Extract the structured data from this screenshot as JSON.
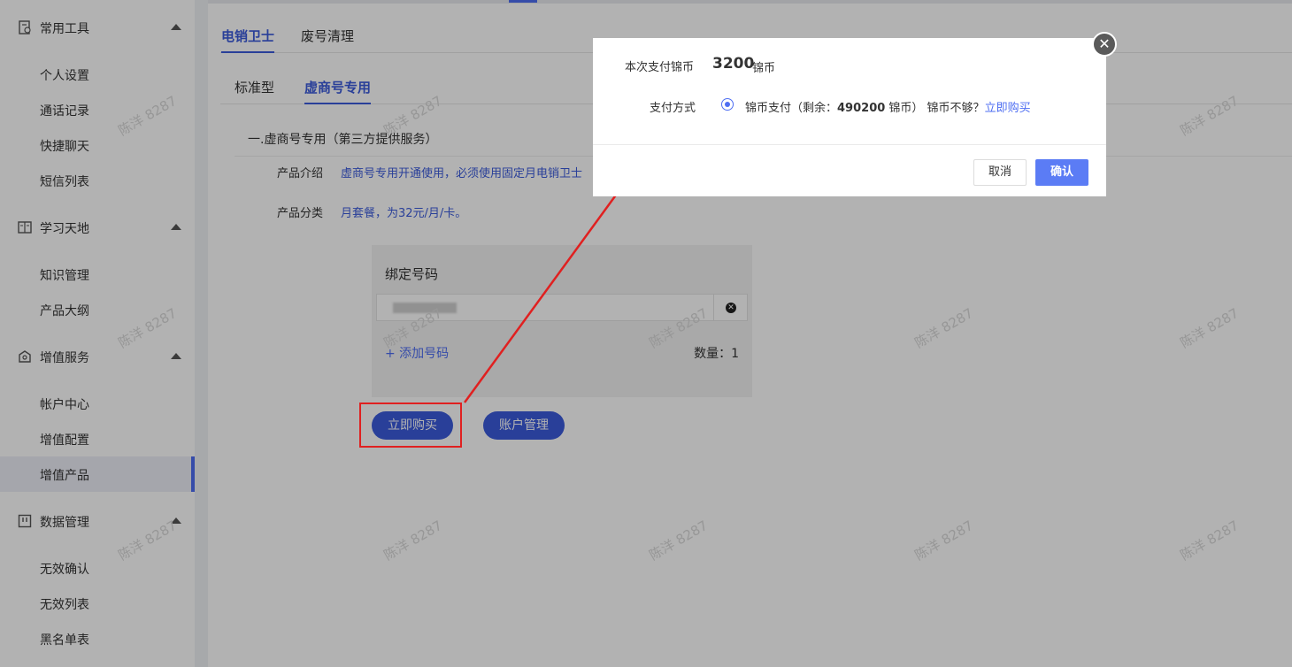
{
  "sidebar": {
    "groups": [
      {
        "label": "常用工具",
        "icon": "tools-doc-icon",
        "items": [
          "个人设置",
          "通话记录",
          "快捷聊天",
          "短信列表"
        ]
      },
      {
        "label": "学习天地",
        "icon": "book-icon",
        "items": [
          "知识管理",
          "产品大纲"
        ]
      },
      {
        "label": "增值服务",
        "icon": "gift-icon",
        "items": [
          "帐户中心",
          "增值配置",
          "增值产品"
        ]
      },
      {
        "label": "数据管理",
        "icon": "data-frame-icon",
        "items": [
          "无效确认",
          "无效列表",
          "黑名单表"
        ]
      }
    ],
    "active_item": "增值产品"
  },
  "tabs_top": [
    "电销卫士",
    "废号清理"
  ],
  "tabs_sub": [
    "标准型",
    "虚商号专用"
  ],
  "section": {
    "title": "一.虚商号专用（第三方提供服务）",
    "intro_label": "产品介绍",
    "intro_value": "虚商号专用开通使用，必须使用固定月电销卫士",
    "category_label": "产品分类",
    "category_value": "月套餐，为32元/月/卡。"
  },
  "bind_panel": {
    "title": "绑定号码",
    "add_label": "+ 添加号码",
    "qty_label": "数量：1"
  },
  "buttons": {
    "buy": "立即购买",
    "account": "账户管理"
  },
  "watermark": "陈洋 8287",
  "modal": {
    "pay_label": "本次支付锦币",
    "amount": "3200",
    "unit": "锦币",
    "method_label": "支付方式",
    "method_text_1": "锦币支付（剩余：",
    "balance": "490200",
    "method_text_2": " 锦币） 锦币不够？",
    "buy_link": "立即购买",
    "cancel": "取消",
    "confirm": "确认",
    "close": "✕"
  },
  "colors": {
    "accent": "#4e6ef2",
    "highlight": "#e02020"
  }
}
